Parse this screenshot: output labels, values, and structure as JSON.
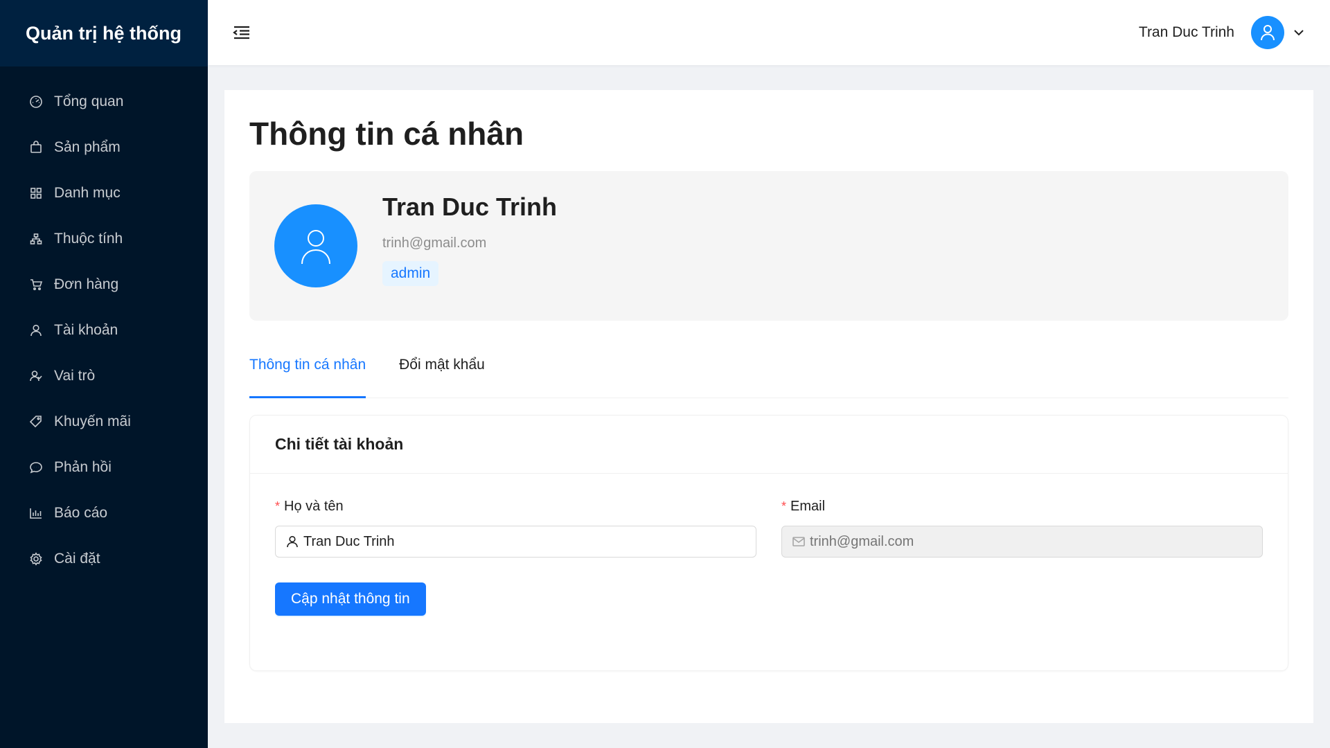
{
  "app": {
    "brand": "Quản trị hệ thống"
  },
  "sidebar": {
    "items": [
      {
        "label": "Tổng quan",
        "icon": "dashboard-icon"
      },
      {
        "label": "Sản phẩm",
        "icon": "shopping-bag-icon"
      },
      {
        "label": "Danh mục",
        "icon": "appstore-icon"
      },
      {
        "label": "Thuộc tính",
        "icon": "cluster-icon"
      },
      {
        "label": "Đơn hàng",
        "icon": "shopping-cart-icon"
      },
      {
        "label": "Tài khoản",
        "icon": "user-icon"
      },
      {
        "label": "Vai trò",
        "icon": "team-icon"
      },
      {
        "label": "Khuyến mãi",
        "icon": "tag-icon"
      },
      {
        "label": "Phản hồi",
        "icon": "comment-icon"
      },
      {
        "label": "Báo cáo",
        "icon": "bar-chart-icon"
      },
      {
        "label": "Cài đặt",
        "icon": "setting-icon"
      }
    ]
  },
  "header": {
    "user_name": "Tran Duc Trinh"
  },
  "page": {
    "title": "Thông tin cá nhân"
  },
  "profile": {
    "name": "Tran Duc Trinh",
    "email": "trinh@gmail.com",
    "role": "admin"
  },
  "tabs": [
    {
      "label": "Thông tin cá nhân",
      "active": true
    },
    {
      "label": "Đổi mật khẩu",
      "active": false
    }
  ],
  "detail": {
    "title": "Chi tiết tài khoản",
    "fullname_label": "Họ và tên",
    "fullname_value": "Tran Duc Trinh",
    "email_label": "Email",
    "email_placeholder": "trinh@gmail.com",
    "submit_label": "Cập nhật thông tin"
  },
  "colors": {
    "sidebar_bg": "#001529",
    "brand_bg": "#002140",
    "primary": "#1677ff",
    "avatar_bg": "#1890ff",
    "required": "#ff4d4f"
  }
}
